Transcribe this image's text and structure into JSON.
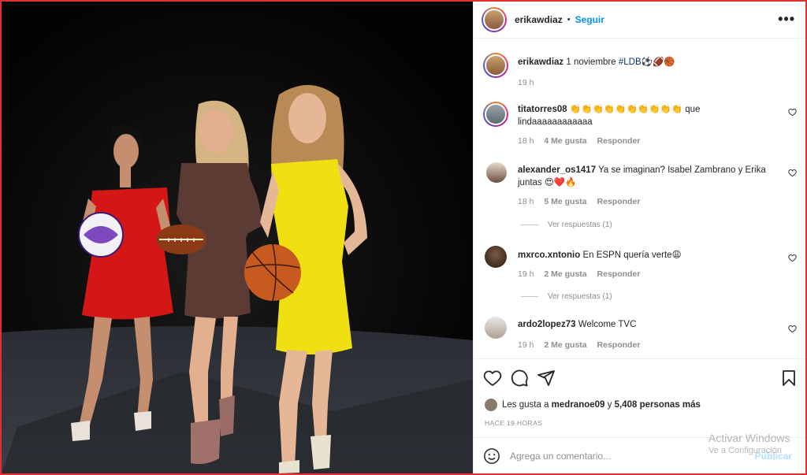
{
  "post": {
    "username": "erikawdiaz",
    "separator": "•",
    "follow_label": "Seguir",
    "more_label": "•••",
    "caption": {
      "username": "erikawdiaz",
      "date": "1 noviembre",
      "hashtag": "#LDB",
      "emojis": "⚽🏈🏀",
      "age": "19 h"
    }
  },
  "comments": [
    {
      "username": "titatorres08",
      "text": "👏👏👏👏👏👏👏👏👏👏 que lindaaaaaaaaaaaa",
      "age": "18 h",
      "likes": "4 Me gusta",
      "reply_label": "Responder",
      "replies": ""
    },
    {
      "username": "alexander_os1417",
      "text": "Ya se imaginan? Isabel Zambrano y Erika juntas 😍❤️🔥",
      "age": "18 h",
      "likes": "5 Me gusta",
      "reply_label": "Responder",
      "replies": "Ver respuestas (1)"
    },
    {
      "username": "mxrco.xntonio",
      "text": "En ESPN quería verte😩",
      "age": "19 h",
      "likes": "2 Me gusta",
      "reply_label": "Responder",
      "replies": "Ver respuestas (1)"
    },
    {
      "username": "ardo2lopez73",
      "text": "Welcome TVC",
      "age": "19 h",
      "likes": "2 Me gusta",
      "reply_label": "Responder",
      "replies": ""
    }
  ],
  "likes": {
    "prefix": "Les gusta a",
    "user": "medranoe09",
    "connector": "y",
    "others": "5,408 personas más"
  },
  "timestamp": "HACE 19 HORAS",
  "add_comment": {
    "placeholder": "Agrega un comentario...",
    "publish": "Publicar"
  },
  "watermark": {
    "line1": "Activar Windows",
    "line2": "Ve a Configuración"
  },
  "icons": {
    "like": "heart-icon",
    "comment": "comment-icon",
    "share": "share-icon",
    "save": "bookmark-icon",
    "emoji": "smiley-icon"
  },
  "colors": {
    "accent": "#0095f6",
    "hashtag": "#00376b",
    "muted": "#8e8e8e",
    "border": "#e0302f"
  }
}
